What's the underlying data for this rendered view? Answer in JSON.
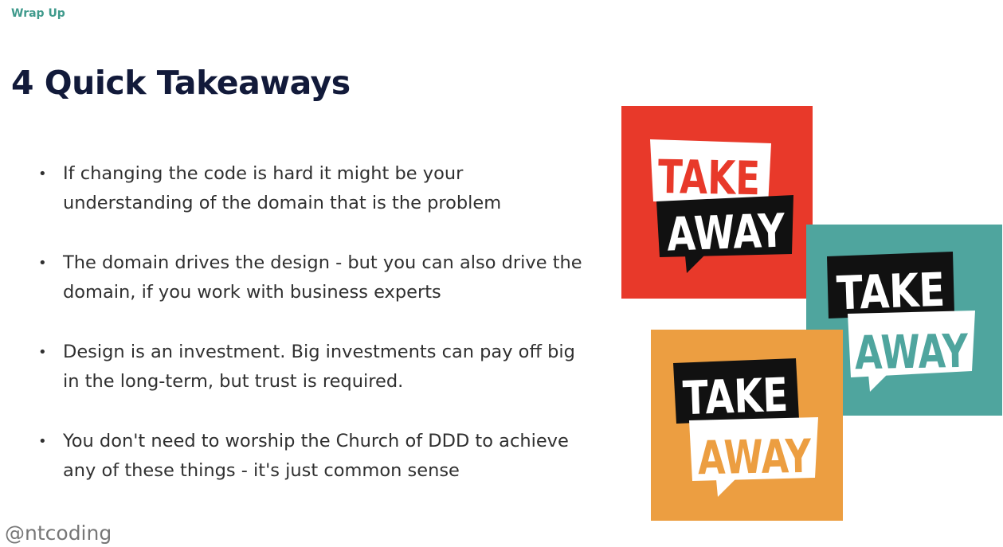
{
  "slide": {
    "section_label": "Wrap Up",
    "title": "4 Quick Takeaways",
    "bullets": [
      "If changing the code is hard it might be your understanding of the domain that is the problem",
      "The domain drives the design - but you can also drive the domain, if you work with business experts",
      "Design is an investment. Big investments can pay off big in the long-term, but trust is required.",
      "You don't need to worship the Church of DDD to achieve any of these things - it's just common sense"
    ],
    "bullet_marker": "•",
    "handle": "@ntcoding"
  },
  "cards": [
    {
      "top_word": "TAKE",
      "bottom_word": "AWAY",
      "background": "#e8392a",
      "icon": "takeaway-speech-bubbles-icon"
    },
    {
      "top_word": "TAKE",
      "bottom_word": "AWAY",
      "background": "#4fa59e",
      "icon": "takeaway-speech-bubbles-icon"
    },
    {
      "top_word": "TAKE",
      "bottom_word": "AWAY",
      "background": "#ec9e41",
      "icon": "takeaway-speech-bubbles-icon"
    }
  ],
  "colors": {
    "accent": "#3f9a8c",
    "title": "#121a3a",
    "body_text": "#303030",
    "handle": "#777777"
  }
}
